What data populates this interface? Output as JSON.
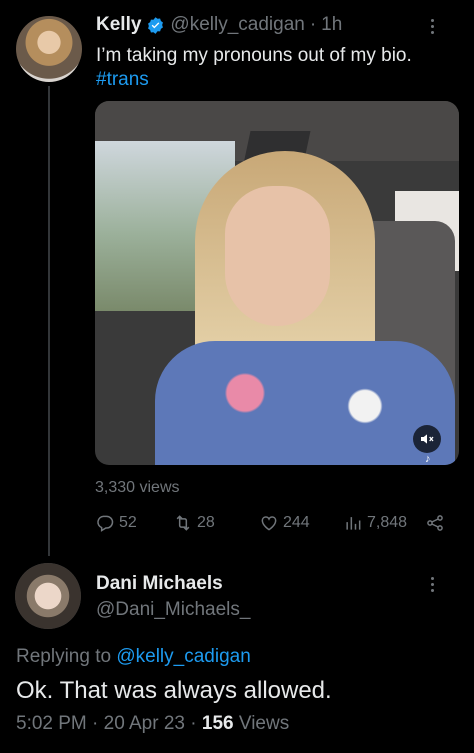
{
  "tweet": {
    "author_name": "Kelly",
    "author_handle": "@kelly_cadigan",
    "separator": "·",
    "time_ago": "1h",
    "text": "I’m taking my pronouns out of my bio.",
    "hashtag": "#trans",
    "media_views": "3,330 views",
    "stats": {
      "replies": "52",
      "retweets": "28",
      "likes": "244",
      "views": "7,848"
    },
    "colors": {
      "link": "#1d9bf0",
      "verified": "#1d9bf0",
      "muted": "#71767b"
    }
  },
  "reply": {
    "author_name": "Dani Michaels",
    "author_handle": "@Dani_Michaels_",
    "replying_prefix": "Replying to",
    "replying_to": "@kelly_cadigan",
    "text": "Ok. That was always allowed.",
    "meta_time": "5:02 PM · 20 Apr 23 ·",
    "meta_views_count": "156",
    "meta_views_label": "Views"
  },
  "icons": {
    "verified": "verified-badge-icon",
    "more": "more-dots-icon",
    "reply": "reply-icon",
    "retweet": "retweet-icon",
    "like": "heart-icon",
    "views": "bar-chart-icon",
    "share": "share-icon",
    "sound": "sound-muted-icon"
  }
}
